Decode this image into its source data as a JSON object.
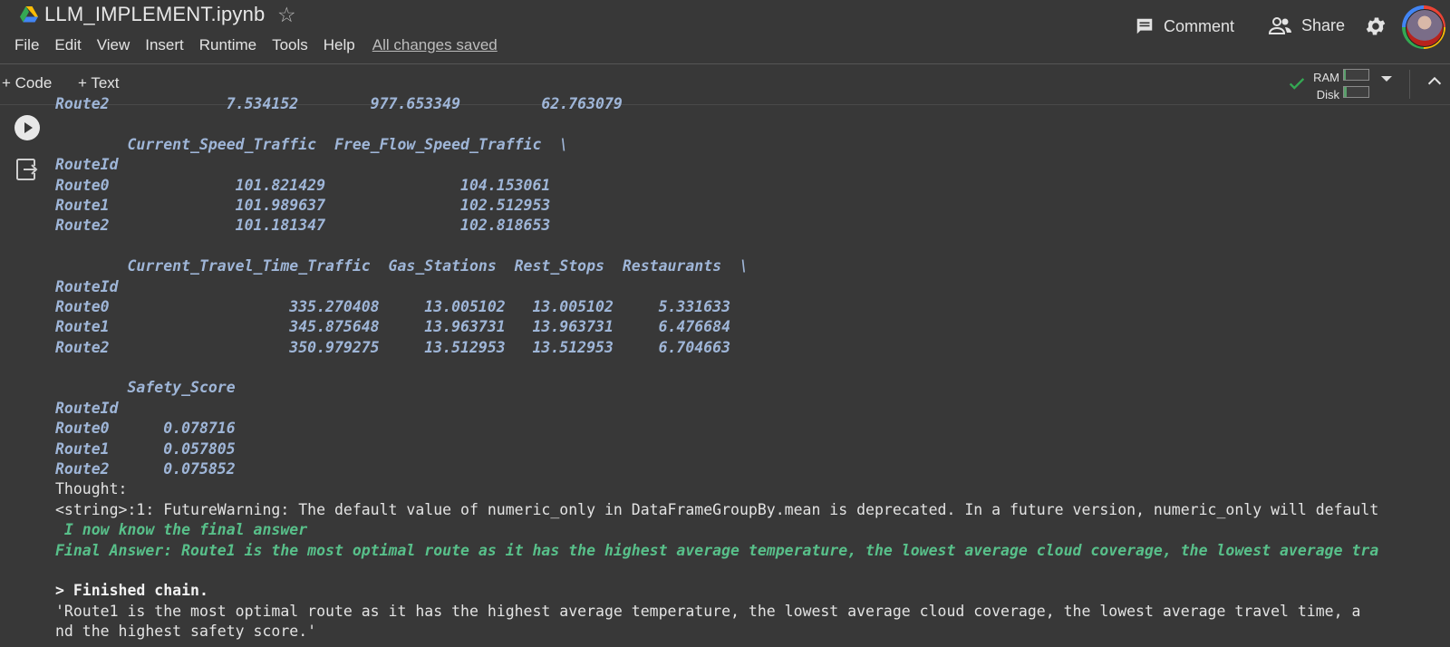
{
  "header": {
    "title": "LLM_IMPLEMENT.ipynb",
    "menu": [
      "File",
      "Edit",
      "View",
      "Insert",
      "Runtime",
      "Tools",
      "Help"
    ],
    "save_status": "All changes saved",
    "comment_label": "Comment",
    "share_label": "Share"
  },
  "toolbar": {
    "add_code_label": "+ Code",
    "add_text_label": "+ Text",
    "ram_label": "RAM",
    "disk_label": "Disk"
  },
  "output": {
    "lines": [
      {
        "text": "Route2             7.534152        977.653349         62.763079",
        "style": "df"
      },
      {
        "text": "",
        "style": "plain"
      },
      {
        "text": "        Current_Speed_Traffic  Free_Flow_Speed_Traffic  \\",
        "style": "df"
      },
      {
        "text": "RouteId",
        "style": "df"
      },
      {
        "text": "Route0              101.821429               104.153061",
        "style": "df"
      },
      {
        "text": "Route1              101.989637               102.512953",
        "style": "df"
      },
      {
        "text": "Route2              101.181347               102.818653",
        "style": "df"
      },
      {
        "text": "",
        "style": "plain"
      },
      {
        "text": "        Current_Travel_Time_Traffic  Gas_Stations  Rest_Stops  Restaurants  \\",
        "style": "df"
      },
      {
        "text": "RouteId",
        "style": "df"
      },
      {
        "text": "Route0                    335.270408     13.005102   13.005102     5.331633",
        "style": "df"
      },
      {
        "text": "Route1                    345.875648     13.963731   13.963731     6.476684",
        "style": "df"
      },
      {
        "text": "Route2                    350.979275     13.512953   13.512953     6.704663",
        "style": "df"
      },
      {
        "text": "",
        "style": "plain"
      },
      {
        "text": "        Safety_Score",
        "style": "df"
      },
      {
        "text": "RouteId",
        "style": "df"
      },
      {
        "text": "Route0      0.078716",
        "style": "df"
      },
      {
        "text": "Route1      0.057805",
        "style": "df"
      },
      {
        "text": "Route2      0.075852",
        "style": "df"
      },
      {
        "text": "Thought:",
        "style": "plain"
      },
      {
        "text": "<string>:1: FutureWarning: The default value of numeric_only in DataFrameGroupBy.mean is deprecated. In a future version, numeric_only will default",
        "style": "plain"
      },
      {
        "text": " I now know the final answer",
        "style": "green"
      },
      {
        "text": "Final Answer: Route1 is the most optimal route as it has the highest average temperature, the lowest average cloud coverage, the lowest average tra",
        "style": "green"
      },
      {
        "text": "",
        "style": "plain"
      },
      {
        "text": "> Finished chain.",
        "style": "bold"
      },
      {
        "text": "'Route1 is the most optimal route as it has the highest average temperature, the lowest average cloud coverage, the lowest average travel time, a",
        "style": "plain"
      },
      {
        "text": "nd the highest safety score.'",
        "style": "plain"
      }
    ]
  }
}
